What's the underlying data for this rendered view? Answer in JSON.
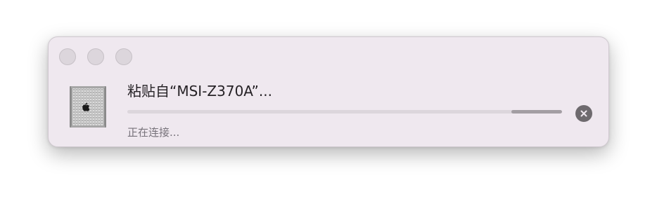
{
  "dialog": {
    "title": "粘贴自“MSI-Z370A”...",
    "status": "正在连接...",
    "progress": {
      "start": 0.884,
      "end": 1.0
    },
    "device_icon": "mac-pro-icon",
    "cancel_icon": "close-circle-icon"
  },
  "window_controls": [
    "close-button",
    "minimize-button",
    "zoom-button"
  ],
  "colors": {
    "window_bg": "#efe8ef",
    "progress_track": "#dcd6dc",
    "progress_fill": "#a39ea3",
    "cancel_bg": "#6e6a6e"
  }
}
